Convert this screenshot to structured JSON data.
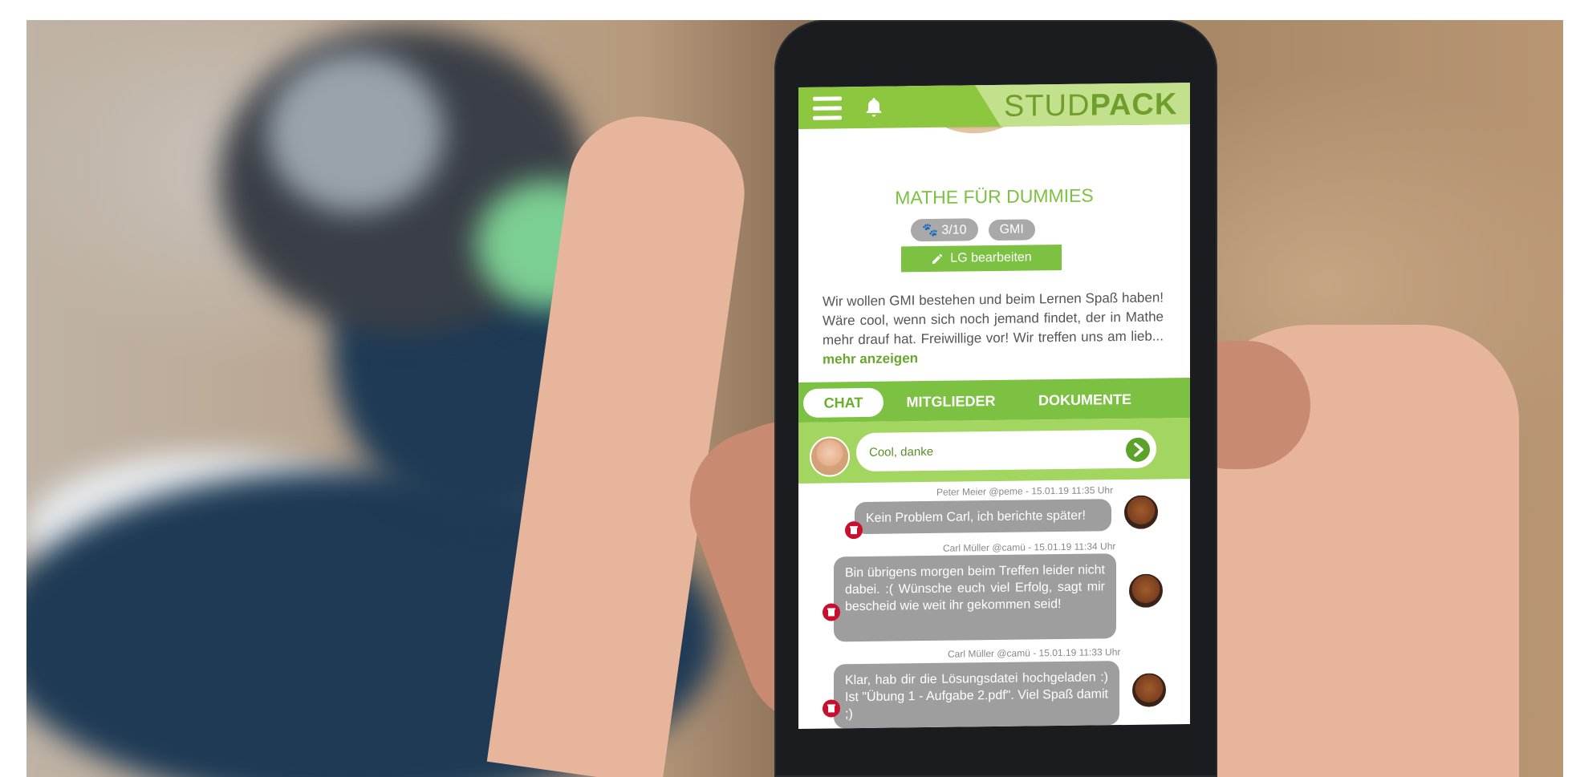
{
  "app": {
    "brand_light": "STUD",
    "brand_bold": "PACK"
  },
  "group": {
    "title": "MATHE FÜR DUMMIES",
    "members_badge": "3/10",
    "course_badge": "GMI",
    "edit_button": "LG bearbeiten",
    "description": "Wir wollen GMI bestehen und beim Lernen Spaß haben! Wäre cool, wenn sich noch jemand findet, der in Mathe mehr drauf hat. Freiwillige vor! Wir treffen uns am lieb...",
    "more_link": "mehr anzeigen"
  },
  "tabs": [
    {
      "label": "CHAT",
      "active": true
    },
    {
      "label": "MITGLIEDER",
      "active": false
    },
    {
      "label": "DOKUMENTE",
      "active": false
    }
  ],
  "composer": {
    "value": "Cool, danke"
  },
  "messages": [
    {
      "meta": "Peter Meier @peme - 15.01.19 11:35 Uhr",
      "text": "Kein Problem Carl, ich berichte später!"
    },
    {
      "meta": "Carl Müller @camü - 15.01.19 11:34 Uhr",
      "text": "Bin übrigens morgen beim Treffen leider nicht dabei. :( Wünsche euch viel Erfolg, sagt mir bescheid wie weit ihr gekommen seid!"
    },
    {
      "meta": "Carl Müller @camü - 15.01.19 11:33 Uhr",
      "text": "Klar, hab dir die Lösungsdatei hochgeladen :) Ist \"Übung 1 - Aufgabe 2.pdf\". Viel Spaß damit ;)"
    }
  ],
  "colors": {
    "accent": "#7cc142",
    "accent_light": "#c3e08c",
    "bubble": "#9e9e9e",
    "delete": "#c8102e"
  },
  "icons": {
    "menu": "hamburger-icon",
    "notifications": "bell-icon",
    "edit": "pencil-icon",
    "members": "paw-icon",
    "send": "send-arrow-icon",
    "delete": "trash-icon"
  }
}
